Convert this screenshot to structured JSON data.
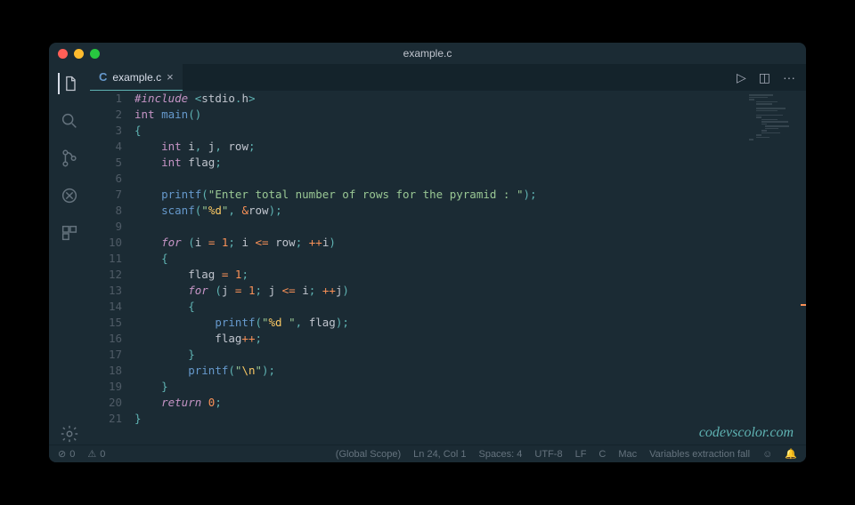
{
  "window": {
    "title": "example.c"
  },
  "tab": {
    "lang_icon": "C",
    "filename": "example.c",
    "close_glyph": "×"
  },
  "tab_actions": {
    "run": "▷",
    "split": "◫",
    "more": "···"
  },
  "code_lines": [
    [
      [
        "inc",
        "#include"
      ],
      [
        "punc",
        " <"
      ],
      [
        "id",
        "stdio"
      ],
      [
        "punc",
        "."
      ],
      [
        "id",
        "h"
      ],
      [
        "punc",
        ">"
      ]
    ],
    [
      [
        "type",
        "int"
      ],
      [
        "id",
        " "
      ],
      [
        "fn",
        "main"
      ],
      [
        "punc",
        "()"
      ]
    ],
    [
      [
        "punc",
        "{"
      ]
    ],
    [
      [
        "id",
        "    "
      ],
      [
        "type",
        "int"
      ],
      [
        "id",
        " i"
      ],
      [
        "punc",
        ","
      ],
      [
        "id",
        " j"
      ],
      [
        "punc",
        ","
      ],
      [
        "id",
        " row"
      ],
      [
        "punc",
        ";"
      ]
    ],
    [
      [
        "id",
        "    "
      ],
      [
        "type",
        "int"
      ],
      [
        "id",
        " flag"
      ],
      [
        "punc",
        ";"
      ]
    ],
    [],
    [
      [
        "id",
        "    "
      ],
      [
        "fn",
        "printf"
      ],
      [
        "punc",
        "("
      ],
      [
        "str",
        "\"Enter total number of rows for the pyramid : \""
      ],
      [
        "punc",
        ");"
      ]
    ],
    [
      [
        "id",
        "    "
      ],
      [
        "fn",
        "scanf"
      ],
      [
        "punc",
        "("
      ],
      [
        "str",
        "\""
      ],
      [
        "fmt",
        "%d"
      ],
      [
        "str",
        "\""
      ],
      [
        "punc",
        ", "
      ],
      [
        "op",
        "&"
      ],
      [
        "id",
        "row"
      ],
      [
        "punc",
        ");"
      ]
    ],
    [],
    [
      [
        "id",
        "    "
      ],
      [
        "kw",
        "for"
      ],
      [
        "punc",
        " ("
      ],
      [
        "id",
        "i "
      ],
      [
        "op",
        "="
      ],
      [
        "id",
        " "
      ],
      [
        "num",
        "1"
      ],
      [
        "punc",
        "; "
      ],
      [
        "id",
        "i "
      ],
      [
        "op",
        "<="
      ],
      [
        "id",
        " row"
      ],
      [
        "punc",
        "; "
      ],
      [
        "op",
        "++"
      ],
      [
        "id",
        "i"
      ],
      [
        "punc",
        ")"
      ]
    ],
    [
      [
        "id",
        "    "
      ],
      [
        "punc",
        "{"
      ]
    ],
    [
      [
        "id",
        "        flag "
      ],
      [
        "op",
        "="
      ],
      [
        "id",
        " "
      ],
      [
        "num",
        "1"
      ],
      [
        "punc",
        ";"
      ]
    ],
    [
      [
        "id",
        "        "
      ],
      [
        "kw",
        "for"
      ],
      [
        "punc",
        " ("
      ],
      [
        "id",
        "j "
      ],
      [
        "op",
        "="
      ],
      [
        "id",
        " "
      ],
      [
        "num",
        "1"
      ],
      [
        "punc",
        "; "
      ],
      [
        "id",
        "j "
      ],
      [
        "op",
        "<="
      ],
      [
        "id",
        " i"
      ],
      [
        "punc",
        "; "
      ],
      [
        "op",
        "++"
      ],
      [
        "id",
        "j"
      ],
      [
        "punc",
        ")"
      ]
    ],
    [
      [
        "id",
        "        "
      ],
      [
        "punc",
        "{"
      ]
    ],
    [
      [
        "id",
        "            "
      ],
      [
        "fn",
        "printf"
      ],
      [
        "punc",
        "("
      ],
      [
        "str",
        "\""
      ],
      [
        "fmt",
        "%d "
      ],
      [
        "str",
        "\""
      ],
      [
        "punc",
        ", "
      ],
      [
        "id",
        "flag"
      ],
      [
        "punc",
        ");"
      ]
    ],
    [
      [
        "id",
        "            flag"
      ],
      [
        "op",
        "++"
      ],
      [
        "punc",
        ";"
      ]
    ],
    [
      [
        "id",
        "        "
      ],
      [
        "punc",
        "}"
      ]
    ],
    [
      [
        "id",
        "        "
      ],
      [
        "fn",
        "printf"
      ],
      [
        "punc",
        "("
      ],
      [
        "str",
        "\""
      ],
      [
        "fmt",
        "\\n"
      ],
      [
        "str",
        "\""
      ],
      [
        "punc",
        ");"
      ]
    ],
    [
      [
        "id",
        "    "
      ],
      [
        "punc",
        "}"
      ]
    ],
    [
      [
        "id",
        "    "
      ],
      [
        "kw",
        "return"
      ],
      [
        "id",
        " "
      ],
      [
        "num",
        "0"
      ],
      [
        "punc",
        ";"
      ]
    ],
    [
      [
        "punc",
        "}"
      ]
    ]
  ],
  "line_start": 1,
  "statusbar": {
    "errors_icon": "⊘",
    "errors": "0",
    "warnings_icon": "⚠",
    "warnings": "0",
    "scope": "(Global Scope)",
    "position": "Ln 24, Col 1",
    "spaces": "Spaces: 4",
    "encoding": "UTF-8",
    "eol": "LF",
    "lang": "C",
    "os": "Mac",
    "task": "Variables extraction fall",
    "smiley": "☺",
    "bell": "🔔"
  },
  "watermark": "codevscolor.com"
}
